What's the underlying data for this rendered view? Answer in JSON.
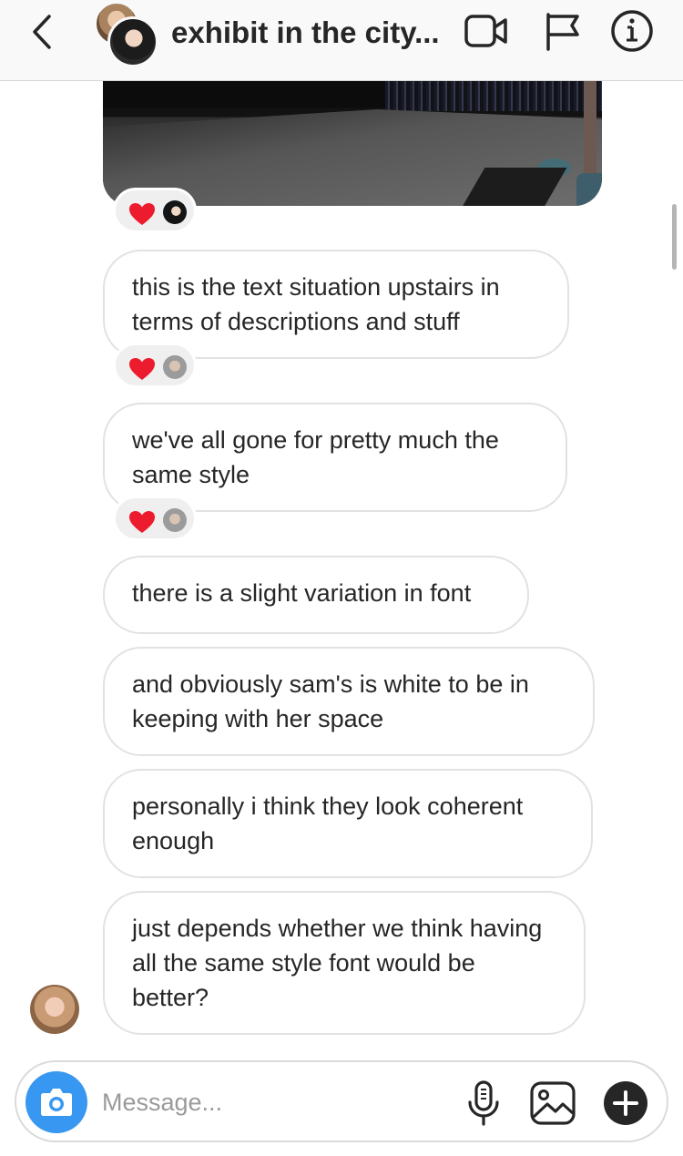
{
  "header": {
    "title": "exhibit in the city...",
    "icons": [
      "back-icon",
      "video-call-icon",
      "flag-icon",
      "info-icon"
    ]
  },
  "messages": [
    {
      "text": "this is the text situation upstairs in terms of descriptions and stuff",
      "reaction": "heart"
    },
    {
      "text": "we've all gone for pretty much the same style",
      "reaction": "heart"
    },
    {
      "text": "there is a slight variation in font"
    },
    {
      "text": "and obviously sam's is white to be in keeping with her space"
    },
    {
      "text": "personally i think they look coherent enough"
    },
    {
      "text": "just depends whether we think having all the same style font would be better?"
    }
  ],
  "composer": {
    "placeholder": "Message...",
    "icons": [
      "camera-icon",
      "microphone-icon",
      "gallery-icon",
      "plus-icon"
    ]
  },
  "colors": {
    "accent": "#3897f0",
    "heart": "#ed1b2e",
    "bubble_border": "#e2e2e2",
    "header_bg": "#f9f9f9"
  }
}
